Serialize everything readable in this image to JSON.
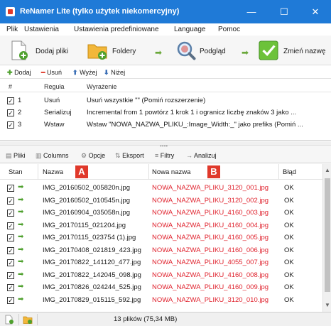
{
  "window": {
    "title": "ReNamer Lite (tylko użytek niekomercyjny)",
    "controls": {
      "minimize": "—",
      "maximize": "☐",
      "close": "✕"
    }
  },
  "menu": [
    "Plik",
    "Ustawienia",
    "Ustawienia predefiniowane",
    "Language",
    "Pomoc"
  ],
  "toolbar": {
    "add_files": "Dodaj pliki",
    "folders": "Foldery",
    "preview": "Podgląd",
    "rename": "Zmień nazwę"
  },
  "rule_ops": {
    "add": "Dodaj",
    "remove": "Usuń",
    "up": "Wyżej",
    "down": "Niżej"
  },
  "rules": {
    "headers": {
      "num": "#",
      "rule": "Reguła",
      "expr": "Wyrażenie"
    },
    "rows": [
      {
        "num": "1",
        "rule": "Usuń",
        "expr": "Usuń wszystkie \"\" (Pomiń rozszerzenie)"
      },
      {
        "num": "2",
        "rule": "Serializuj",
        "expr": "Incremental from 1 powtórz 1 krok 1 i ogranicz liczbę znaków 3 jako ..."
      },
      {
        "num": "3",
        "rule": "Wstaw",
        "expr": "Wstaw \"NOWA_NAZWA_PLIKU_:Image_Width:_\" jako prefiks (Pomiń ..."
      }
    ]
  },
  "panel_tabs": [
    "Pliki",
    "Columns",
    "Opcje",
    "Eksport",
    "Filtry",
    "Analizuj"
  ],
  "files": {
    "headers": {
      "state": "Stan",
      "name": "Nazwa",
      "new_name": "Nowa nazwa",
      "error": "Błąd"
    },
    "badges": {
      "a": "A",
      "b": "B"
    },
    "rows": [
      {
        "name": "IMG_20160502_005820n.jpg",
        "new_name": "NOWA_NAZWA_PLIKU_3120_001.jpg",
        "error": "OK"
      },
      {
        "name": "IMG_20160502_010545n.jpg",
        "new_name": "NOWA_NAZWA_PLIKU_3120_002.jpg",
        "error": "OK"
      },
      {
        "name": "IMG_20160904_035058n.jpg",
        "new_name": "NOWA_NAZWA_PLIKU_4160_003.jpg",
        "error": "OK"
      },
      {
        "name": "IMG_20170115_021204.jpg",
        "new_name": "NOWA_NAZWA_PLIKU_4160_004.jpg",
        "error": "OK"
      },
      {
        "name": "IMG_20170115_023754 (1).jpg",
        "new_name": "NOWA_NAZWA_PLIKU_4160_005.jpg",
        "error": "OK"
      },
      {
        "name": "IMG_20170408_021819_423.jpg",
        "new_name": "NOWA_NAZWA_PLIKU_4160_006.jpg",
        "error": "OK"
      },
      {
        "name": "IMG_20170822_141120_477.jpg",
        "new_name": "NOWA_NAZWA_PLIKU_4055_007.jpg",
        "error": "OK"
      },
      {
        "name": "IMG_20170822_142045_098.jpg",
        "new_name": "NOWA_NAZWA_PLIKU_4160_008.jpg",
        "error": "OK"
      },
      {
        "name": "IMG_20170826_024244_525.jpg",
        "new_name": "NOWA_NAZWA_PLIKU_4160_009.jpg",
        "error": "OK"
      },
      {
        "name": "IMG_20170829_015115_592.jpg",
        "new_name": "NOWA_NAZWA_PLIKU_3120_010.jpg",
        "error": "OK"
      }
    ]
  },
  "status": {
    "summary": "13 plików (75,34 MB)"
  },
  "colors": {
    "title_bar": "#1f7ad7",
    "new_name": "#e0232e",
    "badge": "#e0392b",
    "arrow": "#4ea02d"
  }
}
